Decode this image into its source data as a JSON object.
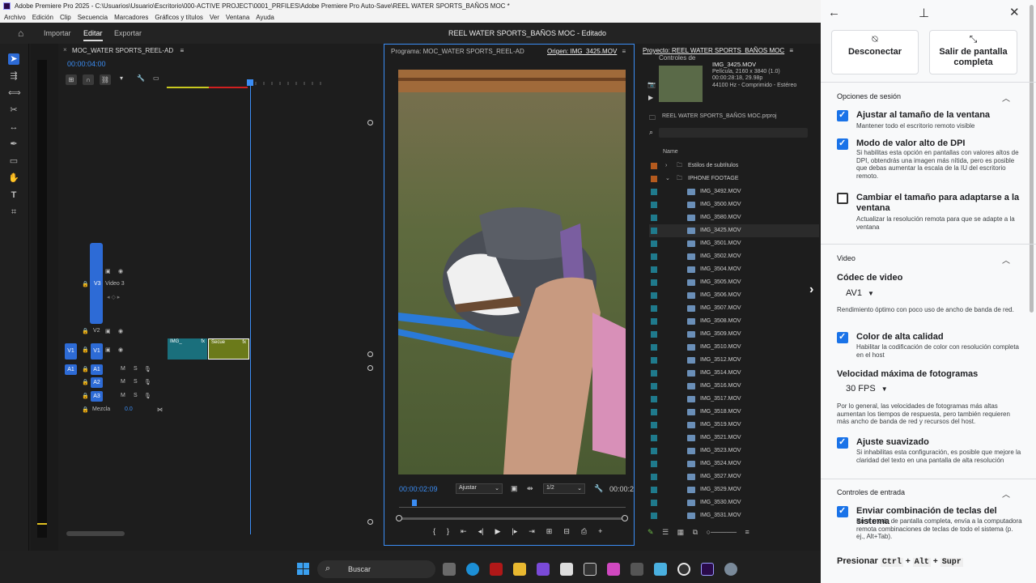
{
  "window": {
    "title": "Adobe Premiere Pro 2025 - C:\\Usuarios\\Usuario\\Escritorio\\000-ACTIVE PROJECT\\0001_PRFILES\\Adobe Premiere Pro Auto-Save\\REEL WATER SPORTS_BAÑOS MOC *",
    "menu": [
      "Archivo",
      "Edición",
      "Clip",
      "Secuencia",
      "Marcadores",
      "Gráficos y títulos",
      "Ver",
      "Ventana",
      "Ayuda"
    ]
  },
  "workspace": {
    "tabs": [
      "Importar",
      "Editar",
      "Exportar"
    ],
    "active_tab": "Editar",
    "document_title": "REEL WATER SPORTS_BAÑOS MOC - Editado"
  },
  "timeline": {
    "sequence_name": "MOC_WATER SPORTS_REEL-AD",
    "timecode": "00:00:04:00",
    "tracks": {
      "v3_label": "V3",
      "v3_name": "Video 3",
      "v2_label": "V2",
      "v1_label": "V1",
      "a1_label": "A1",
      "a2_label": "A2",
      "a3_label": "A3",
      "mix_label": "Mezcla",
      "mix_value": "0.0",
      "m": "M",
      "s": "S"
    },
    "clips": [
      {
        "label": "IMG_",
        "fx": "fx"
      },
      {
        "label": "Secue",
        "fx": "fx"
      }
    ]
  },
  "program_monitor": {
    "tab_program": "Programa: MOC_WATER SPORTS_REEL-AD",
    "tab_source": "Origen: IMG_3425.MOV",
    "timecode": "00:00:02:09",
    "fit": "Ajustar",
    "resolution": "1/2",
    "duration": "00:00:2"
  },
  "project": {
    "tab_project": "Proyecto: REEL WATER SPORTS_BAÑOS MOC",
    "tab_effects": "Controles de",
    "meta": {
      "filename": "IMG_3425.MOV",
      "line1": "Película, 2160 x 3840 (1.0)",
      "line2": "00:00:28:18, 29.98p",
      "line3": "44100 Hz - Comprimido - Estéreo"
    },
    "project_file": "REEL WATER SPORTS_BAÑOS MOC.prproj",
    "column_name": "Name",
    "bins": [
      {
        "name": "Estilos de subtítulos",
        "color": "#b45a1e"
      },
      {
        "name": "IPHONE FOOTAGE",
        "color": "#b45a1e"
      }
    ],
    "files": [
      {
        "name": "IMG_3492.MOV",
        "selected": false
      },
      {
        "name": "IMG_3500.MOV",
        "selected": false
      },
      {
        "name": "IMG_3580.MOV",
        "selected": false
      },
      {
        "name": "IMG_3425.MOV",
        "selected": true
      },
      {
        "name": "IMG_3501.MOV",
        "selected": false
      },
      {
        "name": "IMG_3502.MOV",
        "selected": false
      },
      {
        "name": "IMG_3504.MOV",
        "selected": false
      },
      {
        "name": "IMG_3505.MOV",
        "selected": false
      },
      {
        "name": "IMG_3506.MOV",
        "selected": false
      },
      {
        "name": "IMG_3507.MOV",
        "selected": false
      },
      {
        "name": "IMG_3508.MOV",
        "selected": false
      },
      {
        "name": "IMG_3509.MOV",
        "selected": false
      },
      {
        "name": "IMG_3510.MOV",
        "selected": false
      },
      {
        "name": "IMG_3512.MOV",
        "selected": false
      },
      {
        "name": "IMG_3514.MOV",
        "selected": false
      },
      {
        "name": "IMG_3516.MOV",
        "selected": false
      },
      {
        "name": "IMG_3517.MOV",
        "selected": false
      },
      {
        "name": "IMG_3518.MOV",
        "selected": false
      },
      {
        "name": "IMG_3519.MOV",
        "selected": false
      },
      {
        "name": "IMG_3521.MOV",
        "selected": false
      },
      {
        "name": "IMG_3523.MOV",
        "selected": false
      },
      {
        "name": "IMG_3524.MOV",
        "selected": false
      },
      {
        "name": "IMG_3527.MOV",
        "selected": false
      },
      {
        "name": "IMG_3529.MOV",
        "selected": false
      },
      {
        "name": "IMG_3530.MOV",
        "selected": false
      },
      {
        "name": "IMG_3531.MOV",
        "selected": false
      }
    ],
    "file_color": "#1f7a8c"
  },
  "settings": {
    "disconnect": "Desconectar",
    "exit_fullscreen": "Salir de pantalla completa",
    "session": {
      "title": "Opciones de sesión",
      "fit_title": "Ajustar al tamaño de la ventana",
      "fit_desc": "Mantener todo el escritorio remoto visible",
      "dpi_title": "Modo de valor alto de DPI",
      "dpi_desc": "Si habilitas esta opción en pantallas con valores altos de DPI, obtendrás una imagen más nítida, pero es posible que debas aumentar la escala de la IU del escritorio remoto.",
      "resize_title": "Cambiar el tamaño para adaptarse a la ventana",
      "resize_desc": "Actualizar la resolución remota para que se adapte a la ventana"
    },
    "video": {
      "title": "Video",
      "codec_title": "Códec de video",
      "codec_value": "AV1",
      "codec_desc": "Rendimiento óptimo con poco uso de ancho de banda de red.",
      "color_title": "Color de alta calidad",
      "color_desc": "Habilitar la codificación de color con resolución completa en el host",
      "fps_title": "Velocidad máxima de fotogramas",
      "fps_value": "30 FPS",
      "fps_desc": "Por lo general, las velocidades de fotogramas más altas aumentan los tiempos de respuesta, pero también requieren más ancho de banda de red y recursos del host.",
      "smooth_title": "Ajuste suavizado",
      "smooth_desc": "Si inhabilitas esta configuración, es posible que mejore la claridad del texto en una pantalla de alta resolución"
    },
    "input": {
      "title": "Controles de entrada",
      "combo_title": "Enviar combinación de teclas del sistema",
      "combo_desc": "En el modo de pantalla completa, envía a la computadora remota combinaciones de teclas de todo el sistema (p. ej., Alt+Tab).",
      "press_label": "Presionar",
      "key1": "Ctrl",
      "key2": "Alt",
      "key3": "Supr",
      "plus": "+"
    }
  },
  "taskbar": {
    "search_placeholder": "Buscar"
  }
}
